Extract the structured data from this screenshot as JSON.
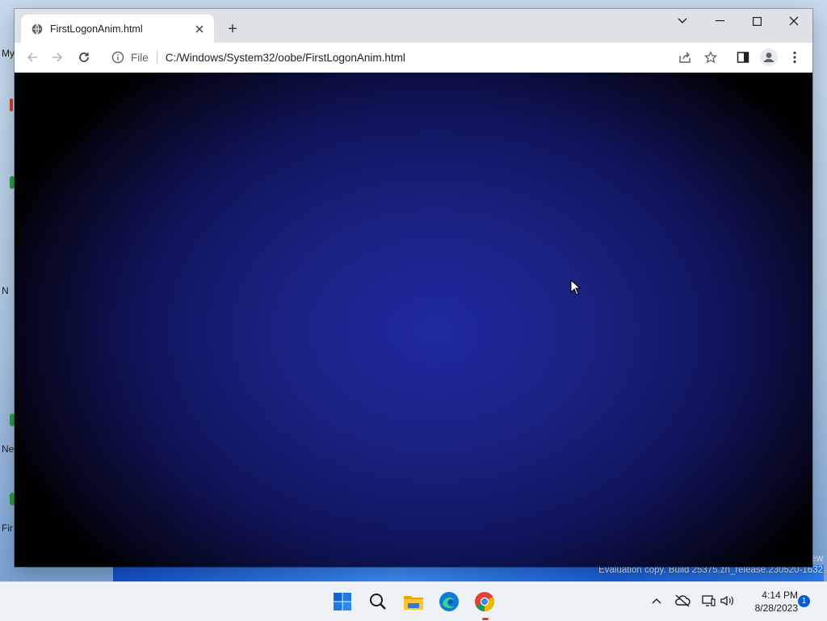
{
  "desktop": {
    "icon_labels": [
      {
        "text": "My",
        "glyph": "computer-icon"
      },
      {
        "text": "N",
        "glyph": "network-icon"
      },
      {
        "text": "Ne",
        "glyph": "edge-shortcut-icon"
      },
      {
        "text": "Fir",
        "glyph": "firefox-shortcut-icon"
      }
    ],
    "watermark": "Evaluation copy. Build 25375.zn_release.230520-1632",
    "watermark_edge": "ew"
  },
  "browser": {
    "tab_title": "FirstLogonAnim.html",
    "new_tab_label": "+",
    "address": {
      "scheme_chip": "File",
      "url": "C:/Windows/System32/oobe/FirstLogonAnim.html"
    },
    "content_colors": {
      "center": "#2029a0",
      "edge": "#000000"
    }
  },
  "taskbar": {
    "apps": [
      "start-icon",
      "search-icon",
      "file-explorer-icon",
      "edge-icon",
      "chrome-icon"
    ],
    "clock_time": "4:14 PM",
    "clock_date": "8/28/2023",
    "notification_count": "1"
  },
  "colors": {
    "accent_blue": "#0a5ad4",
    "titlebar": "#dee1e6",
    "taskbar": "#eef2f7"
  }
}
